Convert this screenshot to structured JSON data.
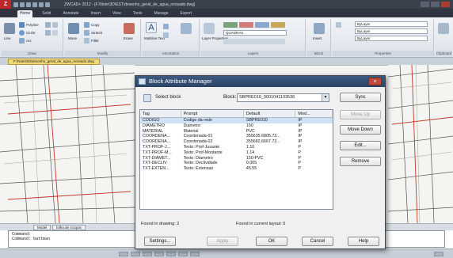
{
  "app": {
    "title": "ZWCAD+ 2012 - [F:\\Note\\3D\\EST\\desenho_geral_de_agua_revisado.dwg]",
    "logo": "Z"
  },
  "ribbon": {
    "tabs": [
      "Home",
      "Solid",
      "Annotate",
      "Insert",
      "View",
      "Tools",
      "Manage",
      "Export"
    ],
    "active_tab": "Home",
    "draw": {
      "label": "Draw",
      "line": "Line",
      "polyline": "Polyline",
      "circle": "Circle",
      "arc": "Arc"
    },
    "modify": {
      "label": "Modify",
      "move": "Move",
      "copy": "Copy",
      "stretch": "Stretch",
      "fillet": "Fillet",
      "erase": "Erase"
    },
    "annotation": {
      "label": "Annotation",
      "multiline_text": "Multiline Text",
      "text": "A"
    },
    "layers": {
      "label": "Layers",
      "layer_properties": "Layer Properties",
      "current_layer": "QUADRAS"
    },
    "block": {
      "label": "Block",
      "insert": "Insert"
    },
    "properties": {
      "label": "Properties",
      "color": "ByLayer",
      "linetype": "ByLayer",
      "lineweight": "ByLayer"
    },
    "clipboard": {
      "label": "Clipboard"
    }
  },
  "doc_tab": "F:\\Note\\3D\\desenho_geral_de_agua_revisado.dwg",
  "layout_tabs": [
    "Model",
    "folha de croquis"
  ],
  "command": {
    "line1": "Command:",
    "line2": "Command: battman"
  },
  "dialog": {
    "title": "Block Attribute Manager",
    "select_block_label": "Select block",
    "block_label": "Block:",
    "block_value": "SBPRE010_0001041103536",
    "columns": [
      "Tag",
      "Prompt",
      "Default",
      "Mod..."
    ],
    "rows": [
      {
        "tag": "CODIGO",
        "prompt": "Codigo da rede",
        "default": "SBPRE010",
        "mod": "IP"
      },
      {
        "tag": "DIAMETRO",
        "prompt": "Diametro",
        "default": "150",
        "mod": "IP"
      },
      {
        "tag": "MATERIAL",
        "prompt": "Material",
        "default": "PVC",
        "mod": "IP"
      },
      {
        "tag": "COORDENA...",
        "prompt": "Coordenada-01",
        "default": "355635.6805.73...",
        "mod": "IP"
      },
      {
        "tag": "COORDENA...",
        "prompt": "Coordenada-02",
        "default": "355682.6667.73...",
        "mod": "IP"
      },
      {
        "tag": "TXT-PROF-J...",
        "prompt": "Texto: Prof-Jusante",
        "default": "1.10",
        "mod": "P"
      },
      {
        "tag": "TXT-PROF-M...",
        "prompt": "Texto: Prof-Montante",
        "default": "1.14",
        "mod": "P"
      },
      {
        "tag": "TXT-DIAMET...",
        "prompt": "Texto: Diametro",
        "default": "150-PVC",
        "mod": "P"
      },
      {
        "tag": "TXT-DECLIV",
        "prompt": "Texto: Declividade",
        "default": "0.005",
        "mod": "P"
      },
      {
        "tag": "TXT-EXTEN...",
        "prompt": "Texto: Extensao",
        "default": "45.55",
        "mod": "P"
      }
    ],
    "selected_row": 0,
    "side_buttons": {
      "sync": "Sync",
      "move_up": "Move Up",
      "move_down": "Move Down",
      "edit": "Edit...",
      "remove": "Remove"
    },
    "found_in_drawing": "Found in drawing: 2",
    "found_in_layout": "Found in current layout: 0",
    "bottom_buttons": {
      "settings": "Settings...",
      "apply": "Apply",
      "ok": "OK",
      "cancel": "Cancel",
      "help": "Help"
    },
    "close": "×"
  },
  "colors": {
    "titlebar": "#3a414b",
    "dialog_title": "#2b4466",
    "selection": "#cfe1f7",
    "drawing_bg": "#f4f4f2",
    "network_line": "#c0392b"
  }
}
